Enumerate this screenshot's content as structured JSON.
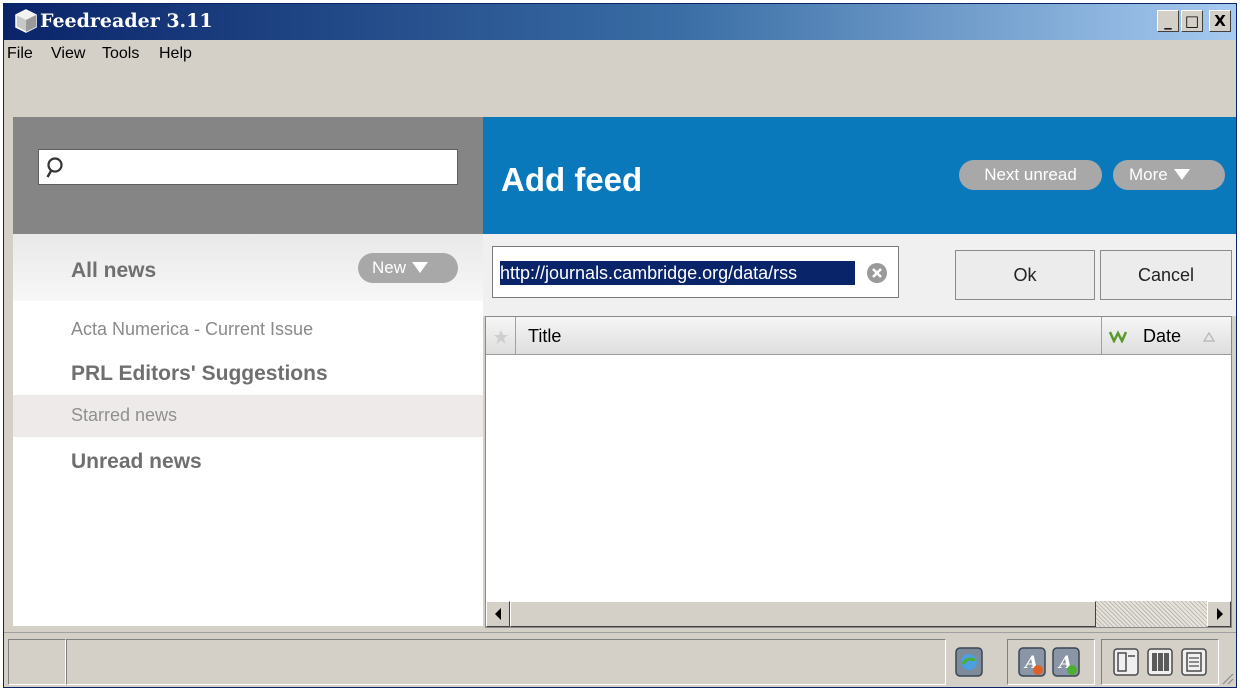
{
  "window": {
    "title": "Feedreader 3.11",
    "controls": {
      "minimize": "_",
      "maximize": "□",
      "close": "X"
    }
  },
  "menu": [
    "File",
    "View",
    "Tools",
    "Help"
  ],
  "search": {
    "placeholder": "",
    "value": ""
  },
  "feeds": {
    "header_label": "All news",
    "new_button": "New",
    "items": [
      {
        "label": "Acta Numerica - Current Issue",
        "bold": false,
        "selected": false
      },
      {
        "label": "PRL Editors' Suggestions",
        "bold": true,
        "selected": false
      },
      {
        "label": "Starred news",
        "bold": false,
        "selected": true
      },
      {
        "label": "Unread news",
        "bold": true,
        "selected": false
      }
    ]
  },
  "content": {
    "title": "Add feed",
    "next_unread_button": "Next unread",
    "more_button": "More",
    "url_value": "http://journals.cambridge.org/data/rss",
    "ok_button": "Ok",
    "cancel_button": "Cancel",
    "columns": {
      "star": "star-icon",
      "title": "Title",
      "feed": "feed-icon",
      "date": "Date"
    }
  },
  "statusbar": {
    "icons": [
      "update-feeds-icon",
      "font-smaller-icon",
      "font-larger-icon",
      "layout-list-icon",
      "layout-columns-icon",
      "layout-vertical-icon"
    ]
  },
  "colors": {
    "accent": "#0a79bc",
    "titlebar_start": "#0a246a",
    "titlebar_end": "#a6caf0",
    "pill": "#a8a8a8",
    "selected_row": "#eeeaea",
    "url_highlight": "#0a246a"
  }
}
